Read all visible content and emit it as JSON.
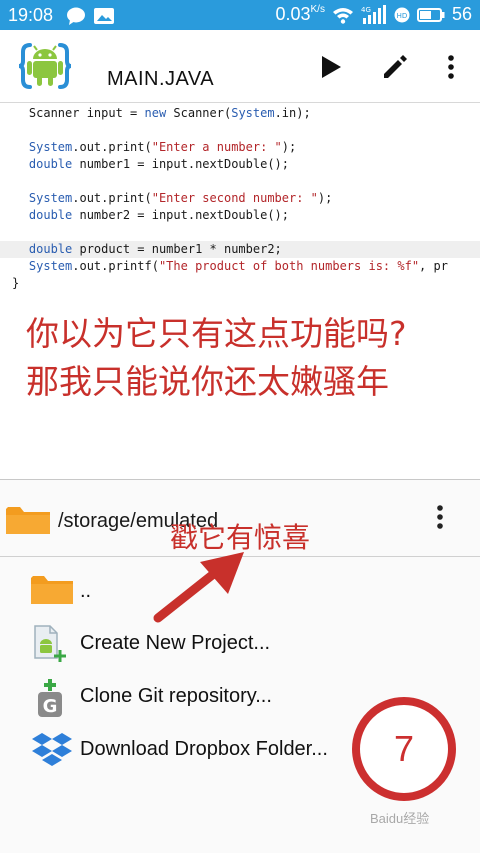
{
  "status_bar": {
    "time": "19:08",
    "net_speed": "0.03",
    "net_unit": "K/s",
    "signal_type": "4G",
    "battery": "56"
  },
  "app_bar": {
    "title": "MAIN.JAVA",
    "icons": [
      "aide-android-logo-icon",
      "play-icon",
      "pencil-icon",
      "more-vert-icon"
    ]
  },
  "code_lines": [
    [
      {
        "c": "pl",
        "t": "    Scanner input = "
      },
      {
        "c": "kw",
        "t": "new"
      },
      {
        "c": "pl",
        "t": " Scanner("
      },
      {
        "c": "kw",
        "t": "System"
      },
      {
        "c": "pl",
        "t": ".in);"
      }
    ],
    [
      {
        "c": "pl",
        "t": ""
      }
    ],
    [
      {
        "c": "kw",
        "t": "    System"
      },
      {
        "c": "pl",
        "t": ".out.print("
      },
      {
        "c": "str",
        "t": "\"Enter a number: \""
      },
      {
        "c": "pl",
        "t": ");"
      }
    ],
    [
      {
        "c": "kw",
        "t": "    double"
      },
      {
        "c": "pl",
        "t": " number1 = input.nextDouble();"
      }
    ],
    [
      {
        "c": "pl",
        "t": ""
      }
    ],
    [
      {
        "c": "kw",
        "t": "    System"
      },
      {
        "c": "pl",
        "t": ".out.print("
      },
      {
        "c": "str",
        "t": "\"Enter second number: \""
      },
      {
        "c": "pl",
        "t": ");"
      }
    ],
    [
      {
        "c": "kw",
        "t": "    double"
      },
      {
        "c": "pl",
        "t": " number2 = input.nextDouble();"
      }
    ],
    [
      {
        "c": "pl",
        "t": ""
      }
    ],
    [
      {
        "c": "kw",
        "t": "    double"
      },
      {
        "c": "pl",
        "t": " product = number1 * number2;"
      }
    ],
    [
      {
        "c": "kw",
        "t": "    System"
      },
      {
        "c": "pl",
        "t": ".out.printf("
      },
      {
        "c": "str",
        "t": "\"The product of both numbers is: %f\""
      },
      {
        "c": "pl",
        "t": ", pr"
      }
    ],
    [
      {
        "c": "pl",
        "t": "}"
      }
    ]
  ],
  "overlay_text": {
    "line1": "你以为它只有这点功能吗?",
    "line2": "那我只能说你还太嫩骚年",
    "callout": "戳它有惊喜",
    "step_number": "7",
    "watermark": "Baidu经验"
  },
  "file_panel": {
    "path": "/storage/emulated",
    "items": [
      {
        "label": "..",
        "icon": "folder-icon"
      },
      {
        "label": "Create New Project...",
        "icon": "new-project-icon"
      },
      {
        "label": "Clone Git repository...",
        "icon": "git-icon"
      },
      {
        "label": "Download Dropbox Folder...",
        "icon": "dropbox-icon"
      }
    ]
  },
  "colors": {
    "status_bar": "#2a9bdc",
    "keyword": "#2a5db0",
    "string": "#b3262a",
    "annotation_red": "#c8302b",
    "folder_orange": "#f39c1f"
  }
}
